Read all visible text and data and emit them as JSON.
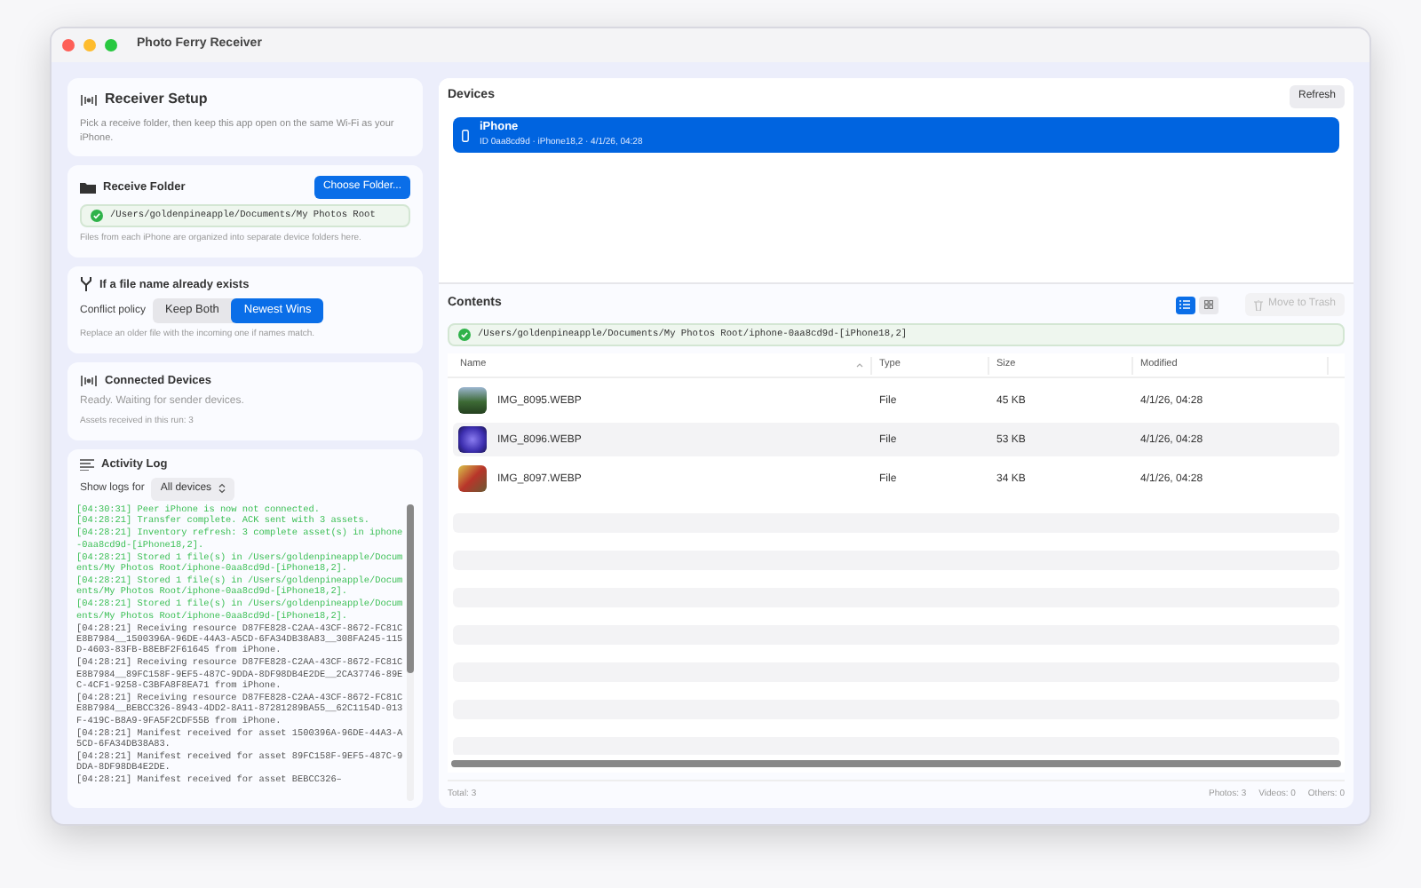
{
  "window": {
    "title": "Photo Ferry Receiver"
  },
  "setup": {
    "title": "Receiver Setup",
    "description": "Pick a receive folder, then keep this app open on the same Wi-Fi as your iPhone."
  },
  "receive_folder": {
    "title": "Receive Folder",
    "button": "Choose Folder...",
    "path": "/Users/goldenpineapple/Documents/My Photos Root",
    "note": "Files from each iPhone are organized into separate device folders here."
  },
  "conflict": {
    "title": "If a file name already exists",
    "label": "Conflict policy",
    "options": [
      {
        "label": "Keep Both",
        "selected": false
      },
      {
        "label": "Newest Wins",
        "selected": true
      }
    ],
    "note": "Replace an older file with the incoming one if names match."
  },
  "connected": {
    "title": "Connected Devices",
    "status": "Ready. Waiting for sender devices.",
    "count": "Assets received in this run: 3"
  },
  "activity_log": {
    "title": "Activity Log",
    "filter_label": "Show logs for",
    "filter_value": "All devices",
    "entries": [
      {
        "kind": "success",
        "text": "[04:30:31] Peer iPhone is now not connected."
      },
      {
        "kind": "success",
        "text": "[04:28:21] Transfer complete. ACK sent with 3 assets."
      },
      {
        "kind": "success",
        "text": "[04:28:21] Inventory refresh: 3 complete asset(s) in iphone-0aa8cd9d-[iPhone18,2]."
      },
      {
        "kind": "success",
        "text": "[04:28:21] Stored 1 file(s) in /Users/goldenpineapple/Documents/My Photos Root/iphone-0aa8cd9d-[iPhone18,2]."
      },
      {
        "kind": "success",
        "text": "[04:28:21] Stored 1 file(s) in /Users/goldenpineapple/Documents/My Photos Root/iphone-0aa8cd9d-[iPhone18,2]."
      },
      {
        "kind": "success",
        "text": "[04:28:21] Stored 1 file(s) in /Users/goldenpineapple/Documents/My Photos Root/iphone-0aa8cd9d-[iPhone18,2]."
      },
      {
        "kind": "info",
        "text": "[04:28:21] Receiving resource D87FE828-C2AA-43CF-8672-FC81CE8B7984__1500396A-96DE-44A3-A5CD-6FA34DB38A83__308FA245-115D-4603-83FB-B8EBF2F61645 from iPhone."
      },
      {
        "kind": "info",
        "text": "[04:28:21] Receiving resource D87FE828-C2AA-43CF-8672-FC81CE8B7984__89FC158F-9EF5-487C-9DDA-8DF98DB4E2DE__2CA37746-89EC-4CF1-9258-C3BFA8F8EA71 from iPhone."
      },
      {
        "kind": "info",
        "text": "[04:28:21] Receiving resource D87FE828-C2AA-43CF-8672-FC81CE8B7984__BEBCC326-8943-4DD2-8A11-87281289BA55__62C1154D-013F-419C-B8A9-9FA5F2CDF55B from iPhone."
      },
      {
        "kind": "info",
        "text": "[04:28:21] Manifest received for asset 1500396A-96DE-44A3-A5CD-6FA34DB38A83."
      },
      {
        "kind": "info",
        "text": "[04:28:21] Manifest received for asset 89FC158F-9EF5-487C-9DDA-8DF98DB4E2DE."
      },
      {
        "kind": "info",
        "text": "[04:28:21] Manifest received for asset BEBCC326–"
      }
    ]
  },
  "devices": {
    "title": "Devices",
    "refresh": "Refresh",
    "items": [
      {
        "name": "iPhone",
        "detail": "ID 0aa8cd9d · iPhone18,2 · 4/1/26, 04:28",
        "selected": true
      }
    ]
  },
  "contents": {
    "title": "Contents",
    "views": [
      {
        "kind": "list",
        "selected": true
      },
      {
        "kind": "grid",
        "selected": false
      }
    ],
    "trash": {
      "label": "Move to Trash",
      "disabled": true
    },
    "path": "/Users/goldenpineapple/Documents/My Photos Root/iphone-0aa8cd9d-[iPhone18,2]",
    "table": {
      "columns": [
        "Name",
        "Type",
        "Size",
        "Modified"
      ],
      "rows": [
        {
          "name": "IMG_8095.WEBP",
          "type": "File",
          "size": "45 KB",
          "modified": "4/1/26, 04:28"
        },
        {
          "name": "IMG_8096.WEBP",
          "type": "File",
          "size": "53 KB",
          "modified": "4/1/26, 04:28"
        },
        {
          "name": "IMG_8097.WEBP",
          "type": "File",
          "size": "34 KB",
          "modified": "4/1/26, 04:28"
        }
      ]
    },
    "footer": {
      "total": "Total: 3",
      "counts": [
        "Photos: 3",
        "Videos: 0",
        "Others: 0"
      ]
    }
  }
}
